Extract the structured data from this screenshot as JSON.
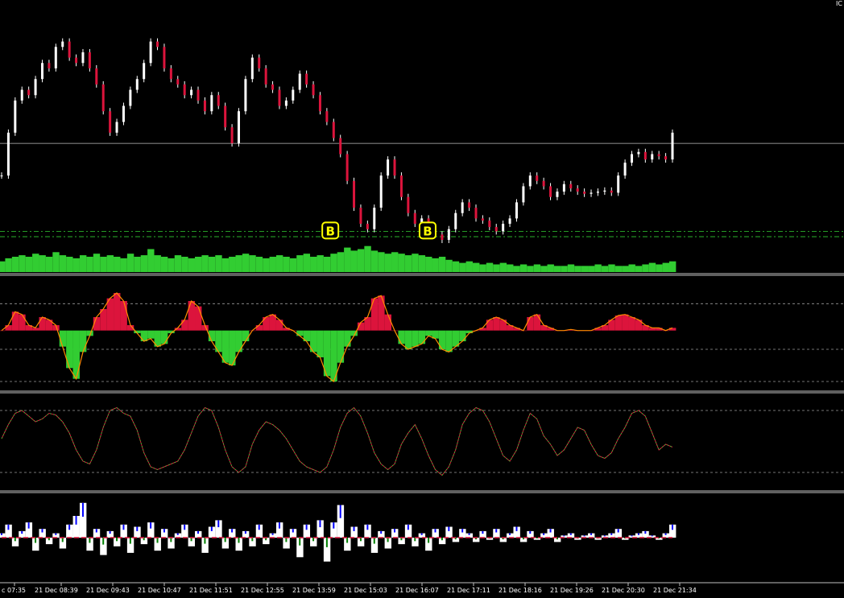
{
  "symbol_label": "IC",
  "colors": {
    "background": "#000000",
    "grid": "#c0c0c0",
    "candle": "#ffffff",
    "candle_down": "#dc143c",
    "volume": "#32cd32",
    "signal_line": "#32cd32",
    "osc_up": "#dc143c",
    "osc_down": "#32cd32",
    "osc_edge": "#ff8c00",
    "stoch_main": "#32cd32",
    "stoch_signal": "#dc143c",
    "hist_up": "#0000ff",
    "hist_down": "#dc143c",
    "hist_extra": "#008000",
    "marker_text": "#ffff00"
  },
  "chart_data": [
    {
      "type": "line",
      "name": "price",
      "marker_label": "B",
      "markers_at_t": [
        0.49,
        0.635
      ],
      "series": [
        {
          "values": [
            -0.3,
            0.1,
            0.4,
            0.5,
            0.45,
            0.6,
            0.75,
            0.7,
            0.9,
            0.95,
            0.8,
            0.75,
            0.85,
            0.7,
            0.55,
            0.3,
            0.1,
            0.2,
            0.35,
            0.5,
            0.6,
            0.75,
            0.95,
            0.9,
            0.7,
            0.6,
            0.55,
            0.45,
            0.5,
            0.4,
            0.3,
            0.45,
            0.35,
            0.15,
            0.0,
            0.3,
            0.6,
            0.8,
            0.7,
            0.55,
            0.5,
            0.35,
            0.4,
            0.5,
            0.65,
            0.55,
            0.45,
            0.3,
            0.2,
            0.05,
            -0.1,
            -0.35,
            -0.6,
            -0.75,
            -0.8,
            -0.6,
            -0.3,
            -0.15,
            -0.3,
            -0.5,
            -0.65,
            -0.75,
            -0.7,
            -0.8,
            -0.85,
            -0.9,
            -0.8,
            -0.65,
            -0.55,
            -0.6,
            -0.7,
            -0.72,
            -0.78,
            -0.82,
            -0.75,
            -0.7,
            -0.55,
            -0.4,
            -0.3,
            -0.35,
            -0.4,
            -0.5,
            -0.45,
            -0.38,
            -0.42,
            -0.45,
            -0.47,
            -0.46,
            -0.45,
            -0.44,
            -0.46,
            -0.3,
            -0.18,
            -0.1,
            -0.08,
            -0.15,
            -0.1,
            -0.12,
            -0.15,
            0.1
          ]
        }
      ],
      "levels": [
        0.0,
        -0.82,
        -0.87
      ],
      "ylim": [
        -1.2,
        1.3
      ]
    },
    {
      "type": "area",
      "name": "volume",
      "series": [
        {
          "values": [
            0.35,
            0.45,
            0.5,
            0.55,
            0.5,
            0.6,
            0.55,
            0.5,
            0.65,
            0.55,
            0.5,
            0.45,
            0.55,
            0.5,
            0.6,
            0.5,
            0.55,
            0.5,
            0.45,
            0.6,
            0.5,
            0.55,
            0.75,
            0.55,
            0.5,
            0.45,
            0.55,
            0.5,
            0.45,
            0.5,
            0.55,
            0.5,
            0.55,
            0.45,
            0.5,
            0.55,
            0.6,
            0.55,
            0.5,
            0.45,
            0.5,
            0.55,
            0.5,
            0.45,
            0.55,
            0.6,
            0.5,
            0.55,
            0.5,
            0.6,
            0.65,
            0.8,
            0.7,
            0.75,
            0.85,
            0.7,
            0.65,
            0.6,
            0.65,
            0.6,
            0.55,
            0.6,
            0.55,
            0.5,
            0.45,
            0.5,
            0.4,
            0.35,
            0.3,
            0.35,
            0.3,
            0.25,
            0.3,
            0.25,
            0.3,
            0.25,
            0.2,
            0.25,
            0.2,
            0.25,
            0.2,
            0.25,
            0.2,
            0.2,
            0.25,
            0.2,
            0.2,
            0.2,
            0.25,
            0.2,
            0.25,
            0.2,
            0.2,
            0.25,
            0.2,
            0.25,
            0.3,
            0.25,
            0.3,
            0.35
          ]
        }
      ],
      "ylim": [
        0,
        1
      ]
    },
    {
      "type": "area",
      "name": "oscillator",
      "series": [
        {
          "values": [
            0.0,
            0.1,
            0.35,
            0.3,
            0.1,
            0.05,
            0.25,
            0.2,
            0.1,
            -0.3,
            -0.7,
            -0.9,
            -0.4,
            -0.1,
            0.25,
            0.4,
            0.6,
            0.7,
            0.55,
            0.1,
            -0.05,
            -0.2,
            -0.15,
            -0.3,
            -0.25,
            -0.05,
            0.05,
            0.2,
            0.55,
            0.45,
            0.1,
            -0.2,
            -0.4,
            -0.6,
            -0.65,
            -0.4,
            -0.2,
            0.0,
            0.1,
            0.25,
            0.3,
            0.2,
            0.05,
            0.0,
            -0.1,
            -0.2,
            -0.4,
            -0.5,
            -0.85,
            -0.95,
            -0.6,
            -0.3,
            -0.1,
            0.15,
            0.25,
            0.6,
            0.65,
            0.3,
            0.0,
            -0.25,
            -0.35,
            -0.3,
            -0.25,
            -0.1,
            -0.15,
            -0.35,
            -0.4,
            -0.3,
            -0.2,
            -0.05,
            0.0,
            0.05,
            0.2,
            0.25,
            0.2,
            0.1,
            0.05,
            0.0,
            0.25,
            0.3,
            0.1,
            0.05,
            0.0,
            0.0,
            0.02,
            0.0,
            0.0,
            0.0,
            0.05,
            0.1,
            0.2,
            0.28,
            0.3,
            0.25,
            0.2,
            0.1,
            0.05,
            0.05,
            0.0,
            0.05
          ]
        }
      ],
      "levels": [
        0.5,
        -0.35,
        -0.95
      ],
      "ylim": [
        -1.1,
        1.0
      ]
    },
    {
      "type": "line",
      "name": "stochastic",
      "series": [
        {
          "values": [
            0.3,
            0.55,
            0.75,
            0.8,
            0.7,
            0.6,
            0.65,
            0.75,
            0.72,
            0.6,
            0.4,
            0.1,
            -0.1,
            -0.15,
            0.1,
            0.5,
            0.8,
            0.85,
            0.75,
            0.7,
            0.45,
            0.05,
            -0.2,
            -0.25,
            -0.2,
            -0.15,
            -0.1,
            0.1,
            0.4,
            0.7,
            0.85,
            0.8,
            0.5,
            0.1,
            -0.2,
            -0.3,
            -0.2,
            0.2,
            0.45,
            0.6,
            0.55,
            0.45,
            0.3,
            0.1,
            -0.1,
            -0.2,
            -0.25,
            -0.3,
            -0.2,
            0.1,
            0.5,
            0.75,
            0.85,
            0.7,
            0.4,
            0.05,
            -0.15,
            -0.25,
            -0.15,
            0.2,
            0.4,
            0.55,
            0.3,
            0.0,
            -0.25,
            -0.35,
            -0.2,
            0.1,
            0.55,
            0.75,
            0.85,
            0.8,
            0.6,
            0.3,
            0.0,
            -0.1,
            0.1,
            0.45,
            0.75,
            0.65,
            0.35,
            0.2,
            0.0,
            0.1,
            0.3,
            0.5,
            0.45,
            0.2,
            0.0,
            -0.05,
            0.05,
            0.3,
            0.5,
            0.75,
            0.8,
            0.7,
            0.4,
            0.1,
            0.2,
            0.15
          ]
        }
      ],
      "levels": [
        0.8,
        -0.3
      ],
      "ylim": [
        -0.6,
        1.1
      ]
    },
    {
      "type": "area",
      "name": "histogram",
      "series": [
        {
          "values": [
            0.1,
            0.3,
            -0.2,
            0.15,
            0.35,
            -0.3,
            0.2,
            -0.15,
            0.1,
            -0.25,
            0.3,
            0.5,
            0.8,
            -0.3,
            0.2,
            -0.4,
            0.15,
            -0.2,
            0.3,
            -0.35,
            0.25,
            -0.15,
            0.35,
            -0.3,
            0.2,
            -0.25,
            0.1,
            0.3,
            -0.2,
            0.15,
            -0.35,
            0.25,
            0.4,
            -0.25,
            0.2,
            -0.3,
            0.15,
            -0.2,
            0.3,
            -0.15,
            0.1,
            0.35,
            -0.25,
            0.2,
            -0.45,
            0.3,
            -0.2,
            0.4,
            -0.55,
            0.35,
            0.75,
            -0.3,
            0.25,
            -0.2,
            0.3,
            -0.35,
            0.15,
            -0.25,
            0.2,
            -0.15,
            0.3,
            -0.2,
            0.1,
            -0.3,
            0.2,
            -0.15,
            0.25,
            -0.1,
            0.2,
            0.1,
            -0.1,
            0.15,
            -0.05,
            0.2,
            -0.1,
            0.1,
            0.25,
            -0.1,
            0.15,
            -0.05,
            0.1,
            0.2,
            -0.1,
            0.05,
            0.1,
            -0.05,
            0.05,
            0.1,
            -0.05,
            0.05,
            0.1,
            0.2,
            -0.05,
            0.05,
            0.1,
            0.15,
            0.05,
            -0.05,
            0.1,
            0.3
          ]
        }
      ],
      "ylim": [
        -1.0,
        1.0
      ]
    }
  ],
  "x_axis": {
    "tick_labels": [
      "c 07:35",
      "21 Dec 08:39",
      "21 Dec 09:43",
      "21 Dec 10:47",
      "21 Dec 11:51",
      "21 Dec 12:55",
      "21 Dec 13:59",
      "21 Dec 15:03",
      "21 Dec 16:07",
      "21 Dec 17:11",
      "21 Dec 18:16",
      "21 Dec 19:26",
      "21 Dec 20:30",
      "21 Dec 21:34"
    ]
  }
}
